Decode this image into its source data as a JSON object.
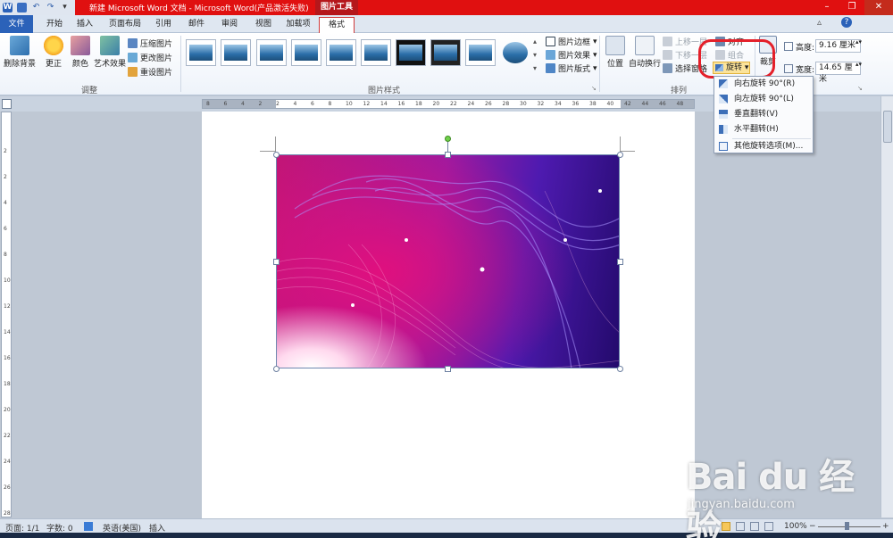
{
  "title_bar": {
    "title": "新建 Microsoft Word 文档 - Microsoft Word(产品激活失败)",
    "context_tool": "图片工具"
  },
  "window_controls": {
    "minimize": "–",
    "restore": "❐",
    "close": "✕"
  },
  "tabs": [
    {
      "label": "文件"
    },
    {
      "label": "开始"
    },
    {
      "label": "插入"
    },
    {
      "label": "页面布局"
    },
    {
      "label": "引用"
    },
    {
      "label": "邮件"
    },
    {
      "label": "审阅"
    },
    {
      "label": "视图"
    },
    {
      "label": "加载项"
    },
    {
      "label": "格式"
    }
  ],
  "ribbon": {
    "adjust": {
      "remove_bg": "删除背景",
      "correct": "更正",
      "color": "颜色",
      "art": "艺术效果",
      "compress": "压缩图片",
      "change": "更改图片",
      "reset": "重设图片",
      "group": "调整"
    },
    "styles": {
      "border": "图片边框",
      "effects": "图片效果",
      "layout": "图片版式",
      "group": "图片样式"
    },
    "arrange": {
      "position": "位置",
      "wrap": "自动换行",
      "forward": "上移一层",
      "backward": "下移一层",
      "selection": "选择窗格",
      "align": "对齐",
      "group_btn": "组合",
      "rotate": "旋转",
      "group": "排列"
    },
    "size": {
      "crop": "裁剪",
      "height_label": "高度:",
      "height": "9.16 厘米",
      "width_label": "宽度:",
      "width": "14.65 厘米"
    }
  },
  "rotate_menu": [
    {
      "label": "向右旋转 90°(R)"
    },
    {
      "label": "向左旋转 90°(L)"
    },
    {
      "label": "垂直翻转(V)"
    },
    {
      "label": "水平翻转(H)"
    },
    {
      "label": "其他旋转选项(M)..."
    }
  ],
  "status": {
    "page": "页面: 1/1",
    "words": "字数: 0",
    "lang": "英语(美国)",
    "mode": "插入",
    "zoom": "100%"
  },
  "ruler": {
    "h": [
      "8",
      "6",
      "4",
      "2",
      "2",
      "4",
      "6",
      "8",
      "10",
      "12",
      "14",
      "16",
      "18",
      "20",
      "22",
      "24",
      "26",
      "28",
      "30",
      "32",
      "34",
      "36",
      "38",
      "40",
      "42",
      "44",
      "46",
      "48"
    ],
    "v": [
      "2",
      "2",
      "4",
      "6",
      "8",
      "10",
      "12",
      "14",
      "16",
      "18",
      "20",
      "22",
      "24",
      "26",
      "28"
    ]
  },
  "watermark": {
    "logo": "Bai du 经验",
    "url": "jingyan.baidu.com"
  }
}
